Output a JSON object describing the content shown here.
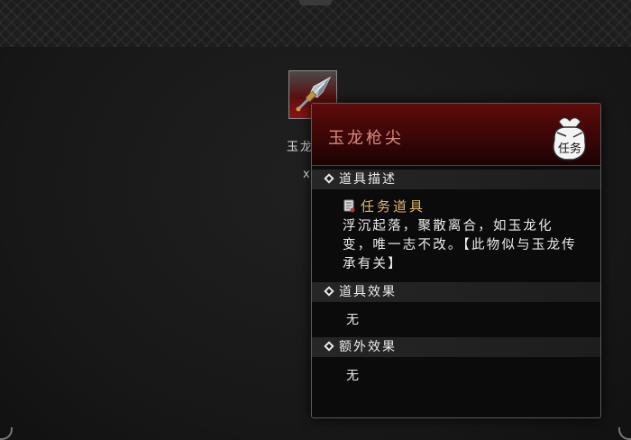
{
  "item": {
    "slot_name": "玉龙枪尖",
    "slot_count_prefix": "x",
    "icon": "spearhead-icon"
  },
  "tooltip": {
    "title": "玉龙枪尖",
    "badge_text": "任务",
    "badge_icon": "mission-bag-icon",
    "sections": {
      "description": {
        "heading": "道具描述",
        "tag": "任务道具",
        "tag_icon": "quest-scroll-icon",
        "text": "浮沉起落，聚散离合，如玉龙化变，唯一志不改。【此物似与玉龙传承有关】"
      },
      "effect": {
        "heading": "道具效果",
        "value": "无"
      },
      "extra_effect": {
        "heading": "额外效果",
        "value": "无"
      }
    }
  },
  "colors": {
    "title": "#d88a82",
    "tag": "#e0b56a",
    "header_red": "#5e0b0b",
    "slot_red": "#8a1414"
  }
}
